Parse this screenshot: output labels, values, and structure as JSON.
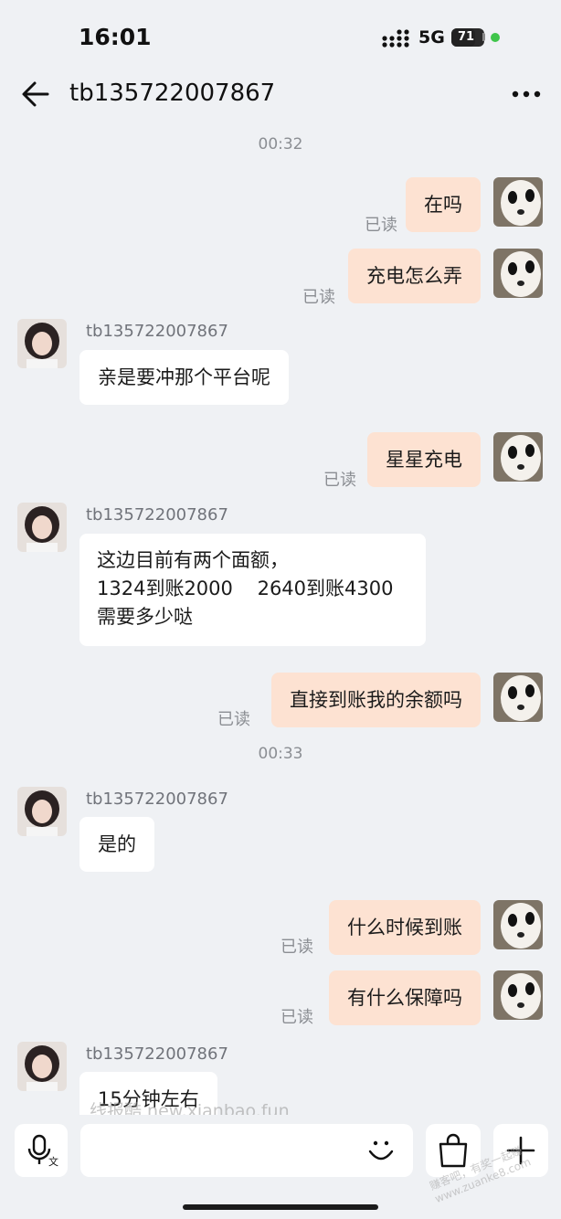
{
  "status_bar": {
    "time": "16:01",
    "network": "5G",
    "battery": "71",
    "battery_level": 0.71,
    "signal_icon": "cellular-signal-icon",
    "dot_color": "#3fc54a"
  },
  "header": {
    "title": "tb135722007867",
    "back_icon": "arrow-left-icon",
    "more_icon": "more-dots-icon"
  },
  "timestamps": [
    "00:32",
    "00:33"
  ],
  "messages": [
    {
      "side": "mine",
      "text": "在吗",
      "read": "已读"
    },
    {
      "side": "mine",
      "text": "充电怎么弄",
      "read": "已读"
    },
    {
      "side": "theirs",
      "sender": "tb135722007867",
      "text": "亲是要冲那个平台呢"
    },
    {
      "side": "mine",
      "text": "星星充电",
      "read": "已读"
    },
    {
      "side": "theirs",
      "sender": "tb135722007867",
      "lines": [
        "这边目前有两个面额，",
        "1324到账2000    2640到账4300",
        "需要多少哒"
      ]
    },
    {
      "side": "mine",
      "text": "直接到账我的余额吗",
      "read": "已读"
    },
    {
      "side": "theirs",
      "sender": "tb135722007867",
      "text": "是的"
    },
    {
      "side": "mine",
      "text": "什么时候到账",
      "read": "已读"
    },
    {
      "side": "mine",
      "text": "有什么保障吗",
      "read": "已读"
    },
    {
      "side": "theirs",
      "sender": "tb135722007867",
      "text": "15分钟左右"
    }
  ],
  "watermark": "线报酷 new.xianbao.fun",
  "corner_watermark": "赚客吧，有奖一起赚 www.zuanke8.com",
  "input_bar": {
    "voice_icon": "microphone-translate-icon",
    "emoji_icon": "smiley-icon",
    "bag_icon": "shopping-bag-icon",
    "plus_icon": "plus-icon"
  },
  "colors": {
    "background": "#eff1f4",
    "bubble_mine": "#fde2d2",
    "bubble_theirs": "#ffffff",
    "muted_text": "#8b8e93"
  }
}
